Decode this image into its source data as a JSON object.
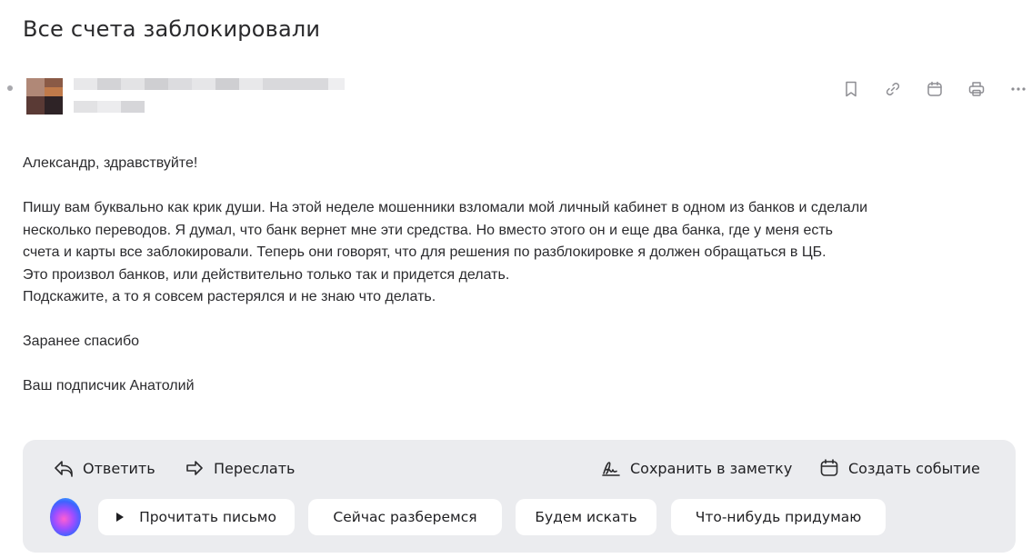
{
  "email": {
    "subject": "Все счета заблокировали",
    "body_lines": [
      "Александр, здравствуйте!",
      "",
      "Пишу вам буквально как крик души. На этой неделе мошенники взломали мой личный кабинет в одном из банков и сделали",
      "несколько переводов. Я думал, что банк вернет мне эти средства. Но вместо этого он и еще два банка, где у меня есть",
      "счета и карты все заблокировали. Теперь они говорят, что для решения по разблокировке я должен обращаться в ЦБ.",
      "Это произвол банков, или действительно только так и придется делать.",
      "Подскажите, а то я совсем растерялся и не знаю что делать.",
      "",
      "Заранее спасибо",
      "",
      "Ваш подписчик Анатолий"
    ]
  },
  "header_actions": [
    {
      "icon": "bookmark-icon"
    },
    {
      "icon": "link-icon"
    },
    {
      "icon": "calendar-icon"
    },
    {
      "icon": "print-icon"
    },
    {
      "icon": "more-icon"
    }
  ],
  "reply_panel": {
    "reply_label": "Ответить",
    "forward_label": "Переслать",
    "save_note_label": "Сохранить в заметку",
    "create_event_label": "Создать событие",
    "suggestions": [
      "Прочитать письмо",
      "Сейчас разберемся",
      "Будем искать",
      "Что-нибудь придумаю"
    ]
  },
  "colors": {
    "panel_bg": "#ebecef",
    "chip_bg": "#ffffff",
    "icon_gray": "#8e8e93",
    "text": "#2b2b2e"
  }
}
